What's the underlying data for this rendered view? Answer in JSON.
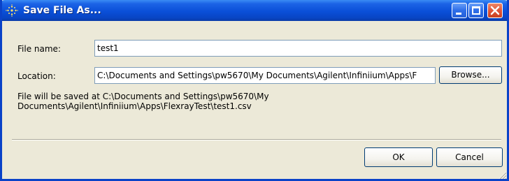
{
  "window": {
    "title": "Save File As...",
    "controls": {
      "minimize": "minimize",
      "maximize": "maximize",
      "close": "close"
    }
  },
  "form": {
    "file_name_label": "File name:",
    "file_name_value": "test1",
    "location_label": "Location:",
    "location_value": "C:\\Documents and Settings\\pw5670\\My Documents\\Agilent\\Infiniium\\Apps\\F",
    "browse_label": "Browse...",
    "info_line1": "File will be saved at C:\\Documents and Settings\\pw5670\\My",
    "info_line2": "Documents\\Agilent\\Infiniium\\Apps\\FlexrayTest\\test1.csv"
  },
  "buttons": {
    "ok_label": "OK",
    "cancel_label": "Cancel"
  },
  "colors": {
    "titlebar": "#0a4fd8",
    "window_bg": "#ece9d8",
    "field_border": "#7f9db9",
    "button_border": "#003c74",
    "close_button": "#e0553a"
  }
}
